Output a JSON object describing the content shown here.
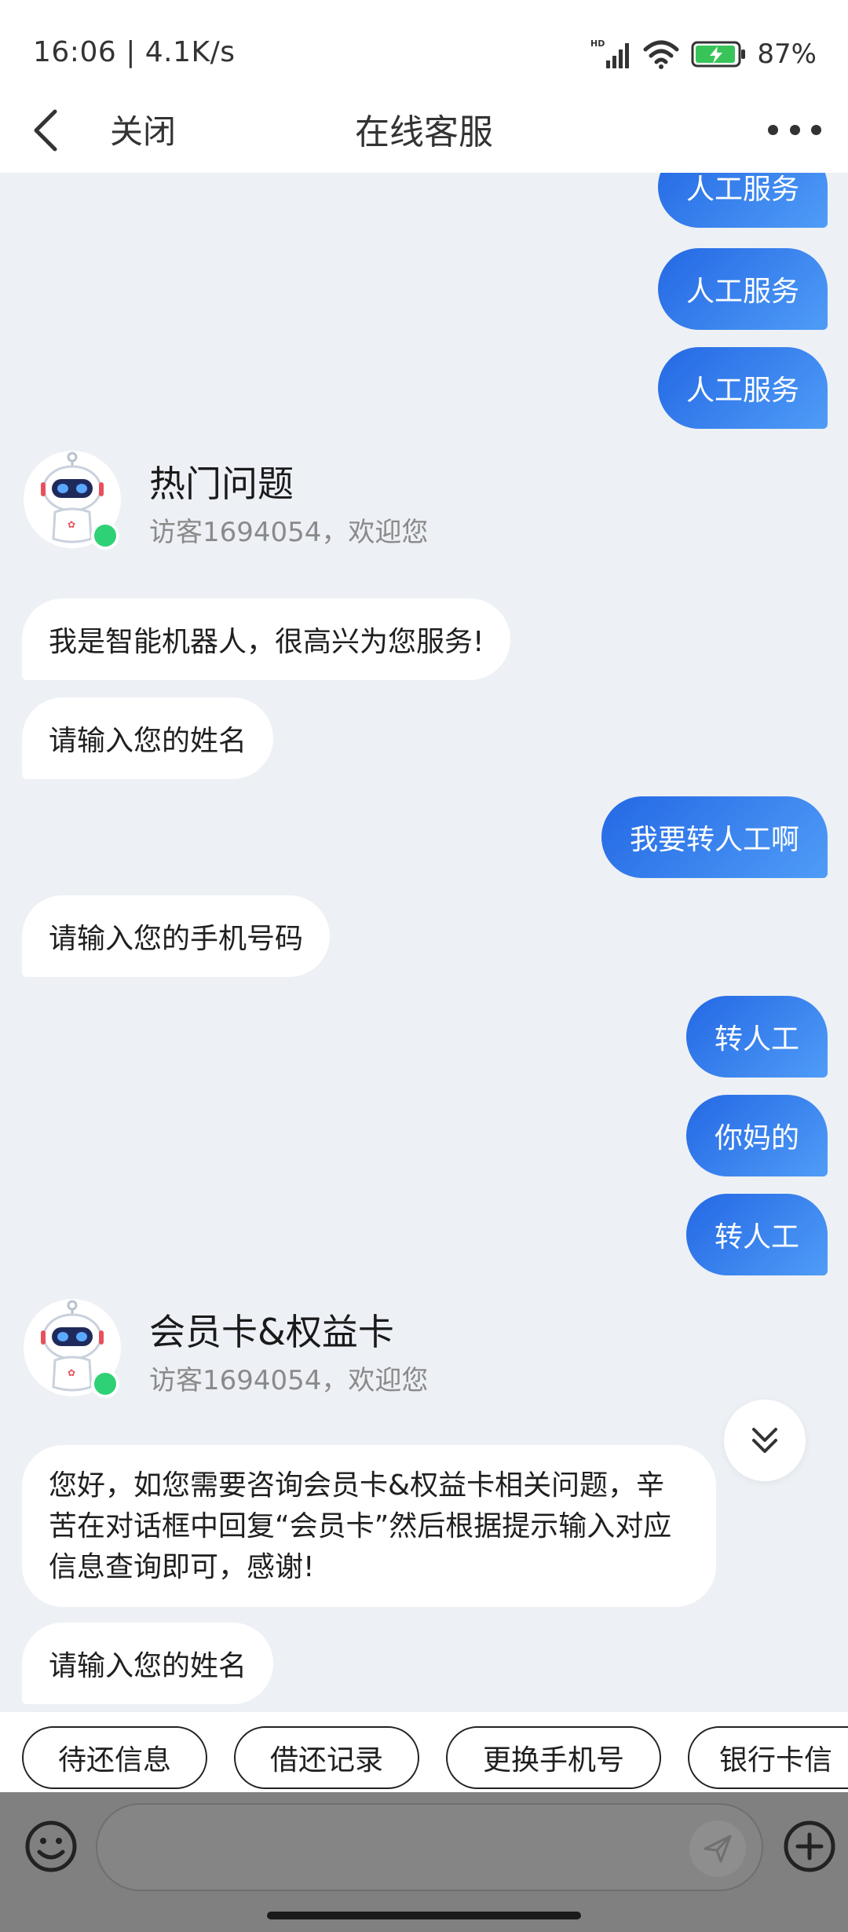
{
  "status_bar": {
    "time_speed": "16:06 | 4.1K/s",
    "battery": "87%",
    "network": "HD"
  },
  "header": {
    "close_label": "关闭",
    "title": "在线客服"
  },
  "messages": {
    "user_1": "人工服务",
    "user_2": "人工服务",
    "user_3": "人工服务",
    "card_1": {
      "title": "热门问题",
      "subtitle": "访客1694054，欢迎您"
    },
    "bot_1": "我是智能机器人，很高兴为您服务!",
    "bot_2": "请输入您的姓名",
    "user_4": "我要转人工啊",
    "bot_3": "请输入您的手机号码",
    "user_5": "转人工",
    "user_6": "你妈的",
    "user_7": "转人工",
    "card_2": {
      "title": "会员卡&权益卡",
      "subtitle": "访客1694054，欢迎您"
    },
    "bot_4": " 您好，如您需要咨询会员卡&权益卡相关问题，辛苦在对话框中回复“会员卡”然后根据提示输入对应信息查询即可，感谢!",
    "bot_5": "请输入您的姓名"
  },
  "quick_replies": [
    "待还信息",
    "借还记录",
    "更换手机号",
    "银行卡信"
  ],
  "colors": {
    "user_bubble_start": "#2468e4",
    "user_bubble_end": "#4f9cf7",
    "chat_background": "#edf0f5",
    "online_dot": "#2fd176"
  }
}
